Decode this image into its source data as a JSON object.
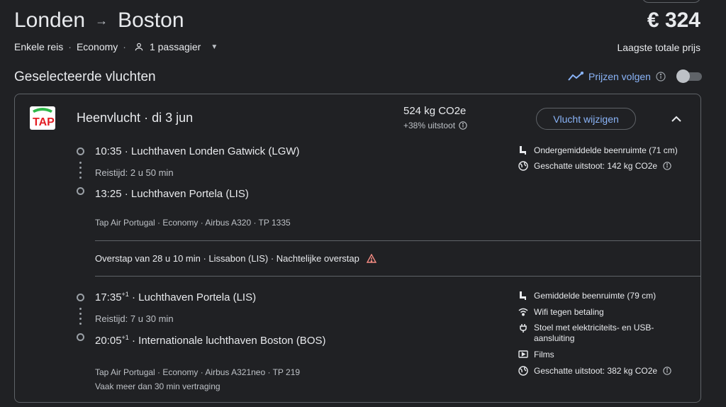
{
  "header": {
    "origin": "Londen",
    "destination": "Boston",
    "price": "€ 324",
    "price_label": "Laagste totale prijs",
    "trip_type": "Enkele reis",
    "cabin": "Economy",
    "passengers": "1 passagier"
  },
  "selected": {
    "title": "Geselecteerde vluchten",
    "track_label": "Prijzen volgen",
    "track_enabled": false
  },
  "leg": {
    "title": "Heenvlucht",
    "date": "di 3 jun",
    "emissions": "524 kg CO2e",
    "emissions_diff": "+38% uitstoot",
    "change_button": "Vlucht wijzigen",
    "airline_logo": "TAP"
  },
  "segments": [
    {
      "dep_time": "10:35",
      "dep_airport": "Luchthaven Londen Gatwick (LGW)",
      "duration": "Reistijd: 2 u 50 min",
      "arr_time": "13:25",
      "arr_airport": "Luchthaven Portela (LIS)",
      "operator": "Tap Air Portugal · Economy · Airbus A320 · TP 1335",
      "amenities": [
        {
          "icon": "legroom-icon",
          "text": "Ondergemiddelde beenruimte (71 cm)"
        },
        {
          "icon": "globe-icon",
          "text": "Geschatte uitstoot: 142 kg CO2e"
        }
      ]
    },
    {
      "dep_time": "17:35",
      "dep_day": "+1",
      "dep_airport": "Luchthaven Portela (LIS)",
      "duration": "Reistijd: 7 u 30 min",
      "arr_time": "20:05",
      "arr_day": "+1",
      "arr_airport": "Internationale luchthaven Boston (BOS)",
      "operator": "Tap Air Portugal · Economy · Airbus A321neo · TP 219",
      "delay_note": "Vaak meer dan 30 min vertraging",
      "amenities": [
        {
          "icon": "legroom-icon",
          "text": "Gemiddelde beenruimte (79 cm)"
        },
        {
          "icon": "wifi-icon",
          "text": "Wifi tegen betaling"
        },
        {
          "icon": "power-plug-icon",
          "text": "Stoel met elektriciteits- en USB-aansluiting"
        },
        {
          "icon": "video-icon",
          "text": "Films"
        },
        {
          "icon": "globe-icon",
          "text": "Geschatte uitstoot: 382 kg CO2e"
        }
      ]
    }
  ],
  "layover": "Overstap van 28 u 10 min · Lissabon (LIS) · Nachtelijke overstap",
  "colors": {
    "background": "#202124",
    "accent": "#8ab4f8",
    "warning": "#f28b82",
    "logo_green": "#2fb84a",
    "logo_red": "#e31e24"
  }
}
